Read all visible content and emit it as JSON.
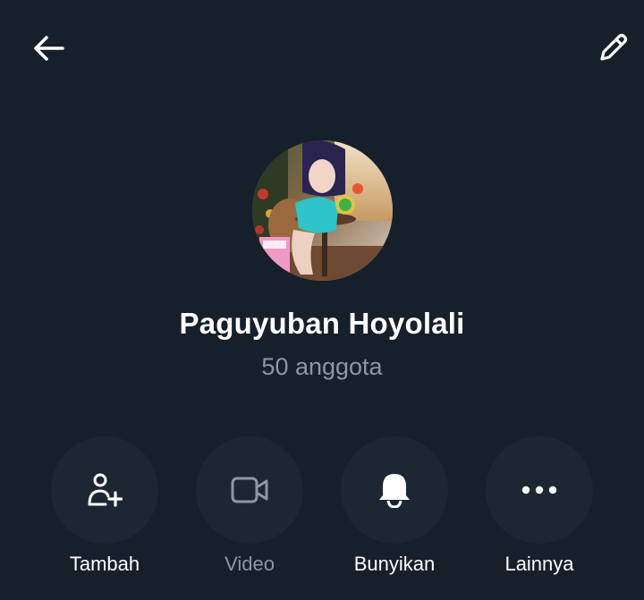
{
  "header": {
    "back_icon": "arrow-left-icon",
    "edit_icon": "pencil-icon"
  },
  "group": {
    "name": "Paguyuban Hoyolali",
    "member_count": "50 anggota"
  },
  "actions": [
    {
      "label": "Tambah",
      "icon": "add-user-icon",
      "enabled": true
    },
    {
      "label": "Video",
      "icon": "video-camera-icon",
      "enabled": false
    },
    {
      "label": "Bunyikan",
      "icon": "bell-icon",
      "enabled": true
    },
    {
      "label": "Lainnya",
      "icon": "more-horizontal-icon",
      "enabled": true
    }
  ],
  "colors": {
    "background": "#15202b",
    "button_bg": "#1c2733",
    "text_primary": "#ffffff",
    "text_secondary": "#8b98a5"
  }
}
